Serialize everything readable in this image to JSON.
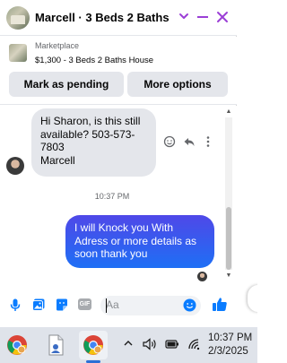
{
  "header": {
    "title": "Marcell · 3 Beds 2 Baths H…",
    "accent_color": "#9b3fd6"
  },
  "marketplace": {
    "label": "Marketplace",
    "item": "$1,300 - 3 Beds 2 Baths House",
    "pending_button": "Mark as pending",
    "more_button": "More options"
  },
  "messages": {
    "incoming_lines": [
      "Hi Sharon, is this still",
      "available? 503-573-",
      "7803",
      "Marcell"
    ],
    "timestamp": "10:37 PM",
    "outgoing": "I will Knock you With Adress or more details  as soon thank you",
    "outgoing_color": "#1e6ff5"
  },
  "composer": {
    "placeholder": "Aa",
    "icons": [
      "mic-icon",
      "photo-icon",
      "sticker-icon",
      "gif-icon",
      "emoji-icon",
      "like-icon"
    ],
    "gif_label": "GIF"
  },
  "taskbar": {
    "time": "10:37 PM",
    "date": "2/3/2025",
    "apps": [
      "chrome-icon",
      "document-icon",
      "chrome-icon"
    ]
  }
}
